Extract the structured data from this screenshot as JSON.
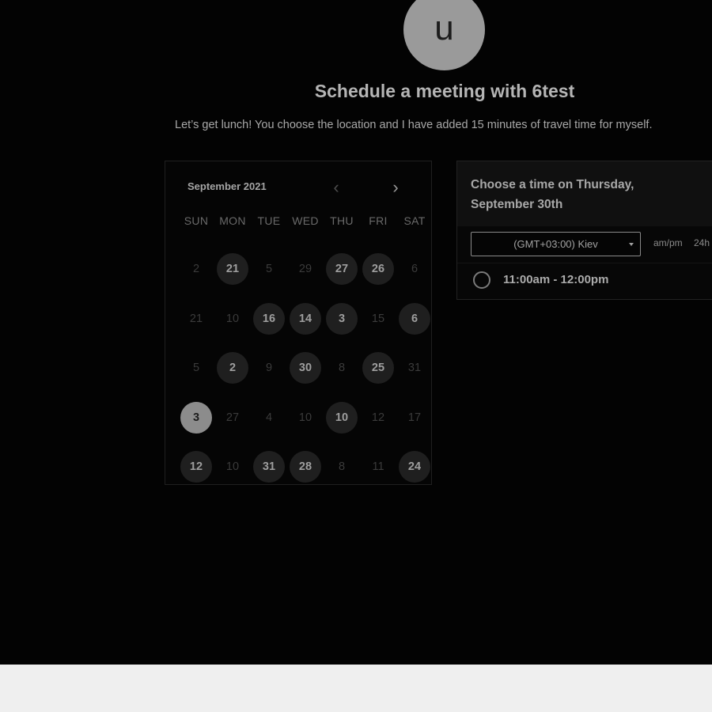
{
  "host": {
    "avatar_initial": "u",
    "title": "Schedule a meeting with 6test",
    "description": "Let’s get lunch! You choose the location and I have added 15 minutes of travel time for myself."
  },
  "calendar": {
    "month_label": "September 2021",
    "prev_icon": "chevron-left-icon",
    "next_icon": "chevron-right-icon",
    "weekdays": [
      "SUN",
      "MON",
      "TUE",
      "WED",
      "THU",
      "FRI",
      "SAT"
    ],
    "weeks": [
      [
        {
          "label": "2",
          "state": "disabled"
        },
        {
          "label": "21",
          "state": "available"
        },
        {
          "label": "5",
          "state": "disabled"
        },
        {
          "label": "29",
          "state": "disabled"
        },
        {
          "label": "27",
          "state": "available"
        },
        {
          "label": "26",
          "state": "available"
        },
        {
          "label": "6",
          "state": "disabled"
        }
      ],
      [
        {
          "label": "21",
          "state": "disabled"
        },
        {
          "label": "10",
          "state": "disabled"
        },
        {
          "label": "16",
          "state": "available"
        },
        {
          "label": "14",
          "state": "available"
        },
        {
          "label": "3",
          "state": "available"
        },
        {
          "label": "15",
          "state": "disabled"
        },
        {
          "label": "6",
          "state": "available"
        }
      ],
      [
        {
          "label": "5",
          "state": "disabled"
        },
        {
          "label": "2",
          "state": "available"
        },
        {
          "label": "9",
          "state": "disabled"
        },
        {
          "label": "30",
          "state": "available"
        },
        {
          "label": "8",
          "state": "disabled"
        },
        {
          "label": "25",
          "state": "available"
        },
        {
          "label": "31",
          "state": "disabled"
        }
      ],
      [
        {
          "label": "3",
          "state": "selected"
        },
        {
          "label": "27",
          "state": "disabled"
        },
        {
          "label": "4",
          "state": "disabled"
        },
        {
          "label": "10",
          "state": "disabled"
        },
        {
          "label": "10",
          "state": "available"
        },
        {
          "label": "12",
          "state": "disabled"
        },
        {
          "label": "17",
          "state": "disabled"
        }
      ],
      [
        {
          "label": "12",
          "state": "available"
        },
        {
          "label": "10",
          "state": "disabled"
        },
        {
          "label": "31",
          "state": "available"
        },
        {
          "label": "28",
          "state": "available"
        },
        {
          "label": "8",
          "state": "disabled"
        },
        {
          "label": "11",
          "state": "disabled"
        },
        {
          "label": "24",
          "state": "available"
        }
      ]
    ]
  },
  "times": {
    "heading": "Choose a time on Thursday, September 30th",
    "timezone": "(GMT+03:00) Kiev",
    "timezone_icon": "caret-down-icon",
    "format_ampm": "am/pm",
    "format_24h": "24h",
    "slots": [
      {
        "label": "11:00am - 12:00pm",
        "selected": false
      }
    ]
  }
}
